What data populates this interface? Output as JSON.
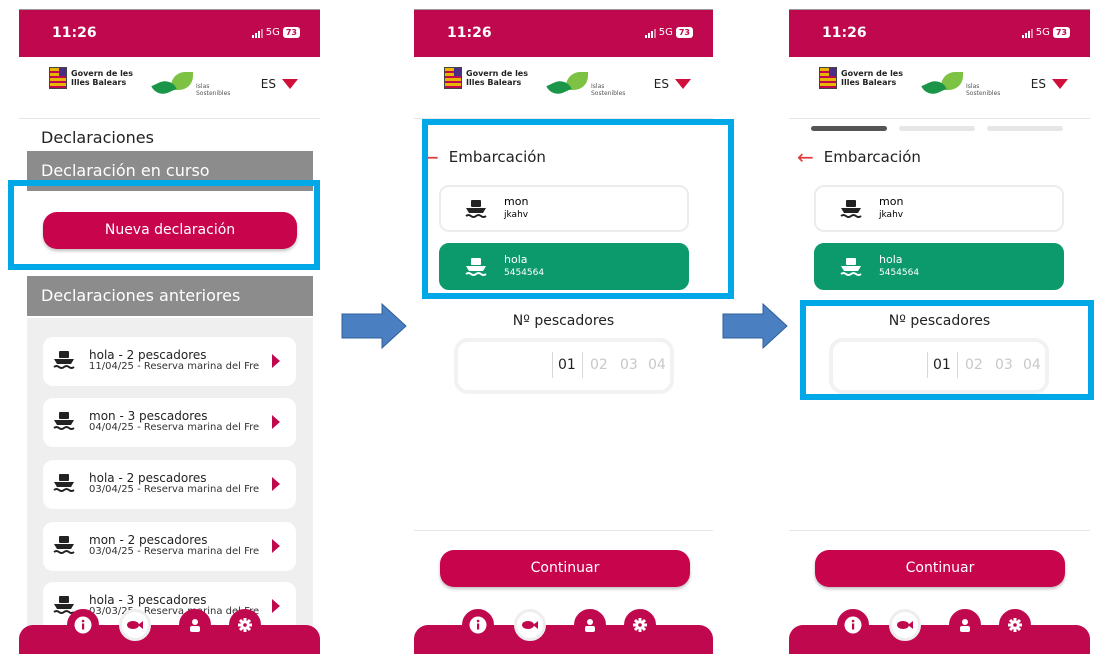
{
  "status": {
    "time": "11:26",
    "network": "5G",
    "battery": "73"
  },
  "header": {
    "gov_line1": "Govern de les",
    "gov_line2": "Illes Balears",
    "islas_line1": "Islas",
    "islas_line2": "Sostenibles",
    "lang": "ES"
  },
  "screen1": {
    "title": "Declaraciones",
    "current_header": "Declaración en curso",
    "new_button": "Nueva declaración",
    "previous_header": "Declaraciones anteriores",
    "items": [
      {
        "title": "hola - 2 pescadores",
        "subtitle": "11/04/25 - Reserva marina del Fre"
      },
      {
        "title": "mon - 3 pescadores",
        "subtitle": "04/04/25 - Reserva marina del Fre"
      },
      {
        "title": "hola - 2 pescadores",
        "subtitle": "03/04/25 - Reserva marina del Fre"
      },
      {
        "title": "mon - 2 pescadores",
        "subtitle": "03/04/25 - Reserva marina del Fre"
      },
      {
        "title": "hola - 3 pescadores",
        "subtitle": "03/03/25 - Reserva marina del Fre"
      }
    ]
  },
  "form": {
    "back_label": "Embarcación",
    "boats": [
      {
        "name": "mon",
        "code": "jkahv",
        "selected": false
      },
      {
        "name": "hola",
        "code": "5454564",
        "selected": true
      }
    ],
    "fishers_label": "Nº pescadores",
    "fishers_options": [
      "01",
      "02",
      "03",
      "04"
    ],
    "fishers_selected": "01",
    "continue_button": "Continuar",
    "progress_step": 1,
    "progress_total": 3
  },
  "nav": {
    "items": [
      "info-icon",
      "fish-icon",
      "person-icon",
      "gear-icon"
    ],
    "active": "fish-icon"
  },
  "colors": {
    "brand": "#c0084e",
    "selected": "#0c9a6c",
    "highlight": "#00a8e8",
    "arrow": "#4a7fc1"
  }
}
